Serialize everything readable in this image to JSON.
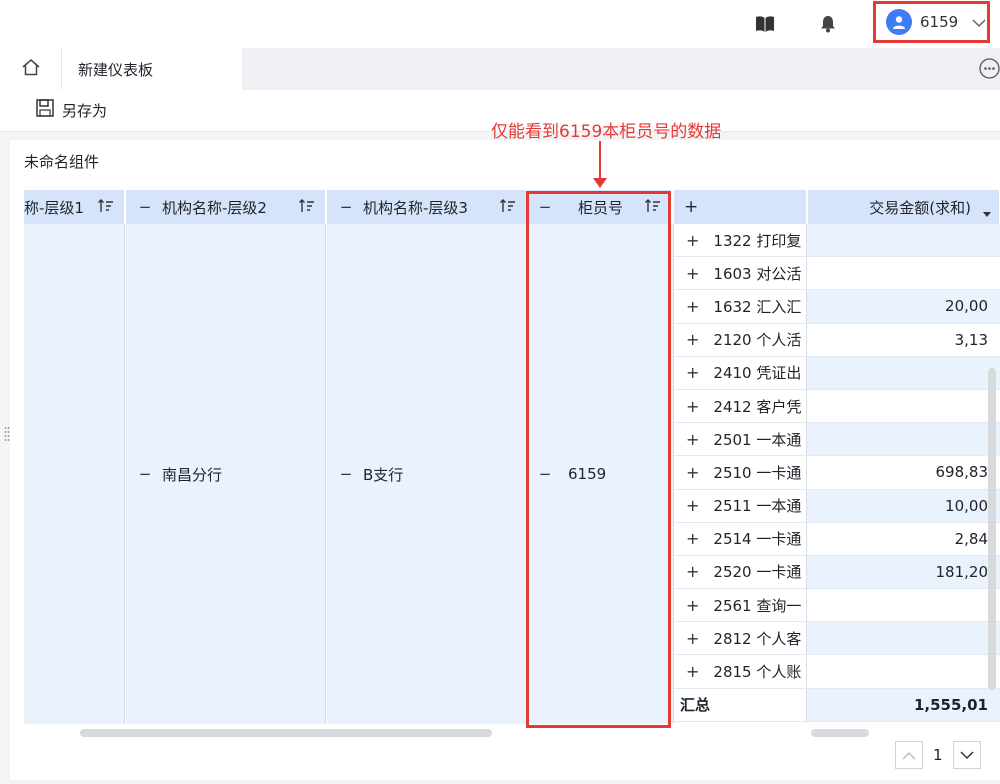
{
  "topbar": {
    "book_icon": "book-icon",
    "bell_icon": "bell-icon",
    "user": {
      "name": "6159",
      "avatar_icon": "user-avatar-icon",
      "dropdown_icon": "chevron-down-icon"
    }
  },
  "tabs": {
    "home_icon": "home-icon",
    "items": [
      {
        "label": "新建仪表板"
      }
    ],
    "more_icon": "more-icon"
  },
  "toolbar": {
    "save_as_label": "另存为",
    "save_icon": "save-icon"
  },
  "annotation": {
    "text": "仅能看到6159本柜员号的数据"
  },
  "widget": {
    "title": "未命名组件",
    "headers": {
      "col1": "称-层级1",
      "col2": "机构名称-层级2",
      "col3": "机构名称-层级3",
      "col4": "柜员号",
      "col5": "+",
      "col6": "交易金额(求和)"
    },
    "groups": {
      "level2": "南昌分行",
      "level3": "B支行",
      "teller": "6159"
    },
    "rows": [
      {
        "label": "1322 打印复",
        "value": ""
      },
      {
        "label": "1603 对公活",
        "value": ""
      },
      {
        "label": "1632 汇入汇",
        "value": "20,00"
      },
      {
        "label": "2120 个人活",
        "value": "3,13"
      },
      {
        "label": "2410 凭证出",
        "value": ""
      },
      {
        "label": "2412 客户凭",
        "value": ""
      },
      {
        "label": "2501 一本通",
        "value": ""
      },
      {
        "label": "2510 一卡通",
        "value": "698,83"
      },
      {
        "label": "2511 一本通",
        "value": "10,00"
      },
      {
        "label": "2514 一卡通",
        "value": "2,84"
      },
      {
        "label": "2520 一卡通",
        "value": "181,20"
      },
      {
        "label": "2561 查询一",
        "value": ""
      },
      {
        "label": "2812 个人客",
        "value": ""
      },
      {
        "label": "2815 个人账",
        "value": ""
      }
    ],
    "total": {
      "label": "汇总",
      "value": "1,555,01"
    }
  },
  "pager": {
    "page": "1"
  },
  "colors": {
    "accent": "#3f7cf4",
    "highlight": "#e53935",
    "header_bg": "#d6e4fb",
    "row_bg": "#eaf2fd"
  }
}
